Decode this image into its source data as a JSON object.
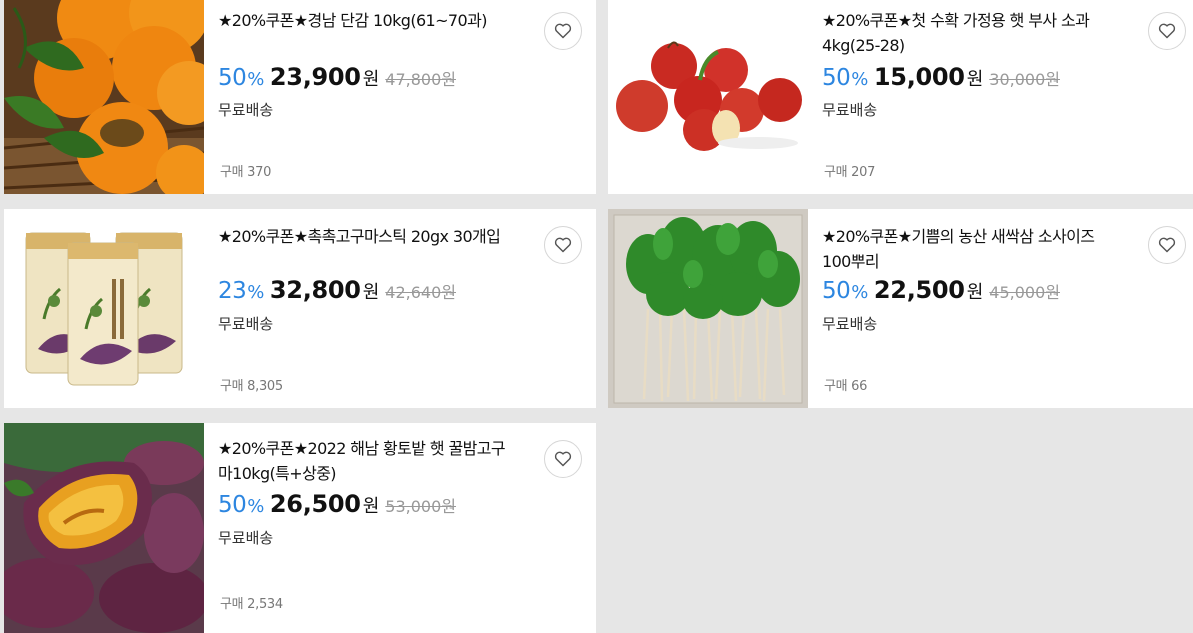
{
  "products": [
    {
      "title": "★20%쿠폰★경남 단감 10kg(61~70과)",
      "discount": "50",
      "percent_sign": "%",
      "price": "23,900",
      "currency": "원",
      "original_price": "47,800원",
      "shipping": "무료배송",
      "purchases": "구매 370",
      "thumbnail": "persimmon-photo"
    },
    {
      "title": "★20%쿠폰★첫 수확 가정용 햇 부사 소과 4kg(25-28)",
      "discount": "50",
      "percent_sign": "%",
      "price": "15,000",
      "currency": "원",
      "original_price": "30,000원",
      "shipping": "무료배송",
      "purchases": "구매 207",
      "thumbnail": "apple-photo"
    },
    {
      "title": "★20%쿠폰★촉촉고구마스틱 20gx 30개입",
      "discount": "23",
      "percent_sign": "%",
      "price": "32,800",
      "currency": "원",
      "original_price": "42,640원",
      "shipping": "무료배송",
      "purchases": "구매 8,305",
      "thumbnail": "sweet-potato-stick-pack-photo"
    },
    {
      "title": "★20%쿠폰★기쁨의 농산 새싹삼 소사이즈 100뿌리",
      "discount": "50",
      "percent_sign": "%",
      "price": "22,500",
      "currency": "원",
      "original_price": "45,000원",
      "shipping": "무료배송",
      "purchases": "구매 66",
      "thumbnail": "ginseng-sprout-photo"
    },
    {
      "title": "★20%쿠폰★2022 해남 황토밭 햇 꿀밤고구마10kg(특+상중)",
      "discount": "50",
      "percent_sign": "%",
      "price": "26,500",
      "currency": "원",
      "original_price": "53,000원",
      "shipping": "무료배송",
      "purchases": "구매 2,534",
      "thumbnail": "roasted-sweet-potato-photo"
    }
  ],
  "colors": {
    "discount": "#2d86e0",
    "background": "#e6e6e6",
    "card": "#ffffff"
  },
  "icons": {
    "wishlist": "heart-icon"
  }
}
